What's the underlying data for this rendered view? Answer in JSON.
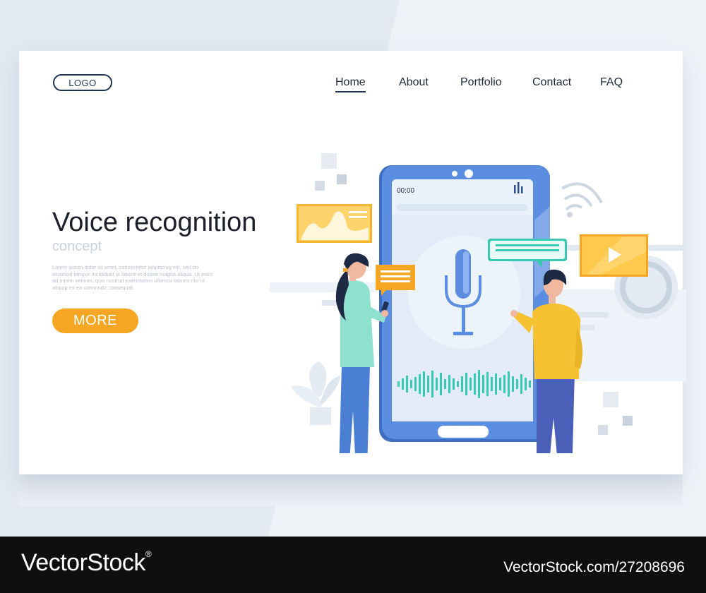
{
  "header": {
    "logo": "LOGO",
    "nav": [
      {
        "label": "Home",
        "active": true
      },
      {
        "label": "About"
      },
      {
        "label": "Portfolio"
      },
      {
        "label": "Contact"
      },
      {
        "label": "FAQ"
      }
    ]
  },
  "hero": {
    "title": "Voice recognition",
    "subtitle": "concept",
    "body": "Lorem ipsum dolor sit amet, consectetur adipiscing elit, sed do eiusmod tempor incididunt ut labore et dolore magna aliqua. Ut enim ad minim veniam, quis nostrud exercitation ullamco laboris nisi ut aliquip ex ea commodo consequat.",
    "button": "MORE"
  },
  "phone": {
    "time": "00:00"
  },
  "footer": {
    "brand": "VectorStock",
    "reg": "®",
    "id": "VectorStock.com/27208696"
  },
  "colors": {
    "accent": "#f5a623",
    "phone_blue": "#4a7fd4",
    "teal": "#38c9b3",
    "navy": "#1e3557"
  }
}
